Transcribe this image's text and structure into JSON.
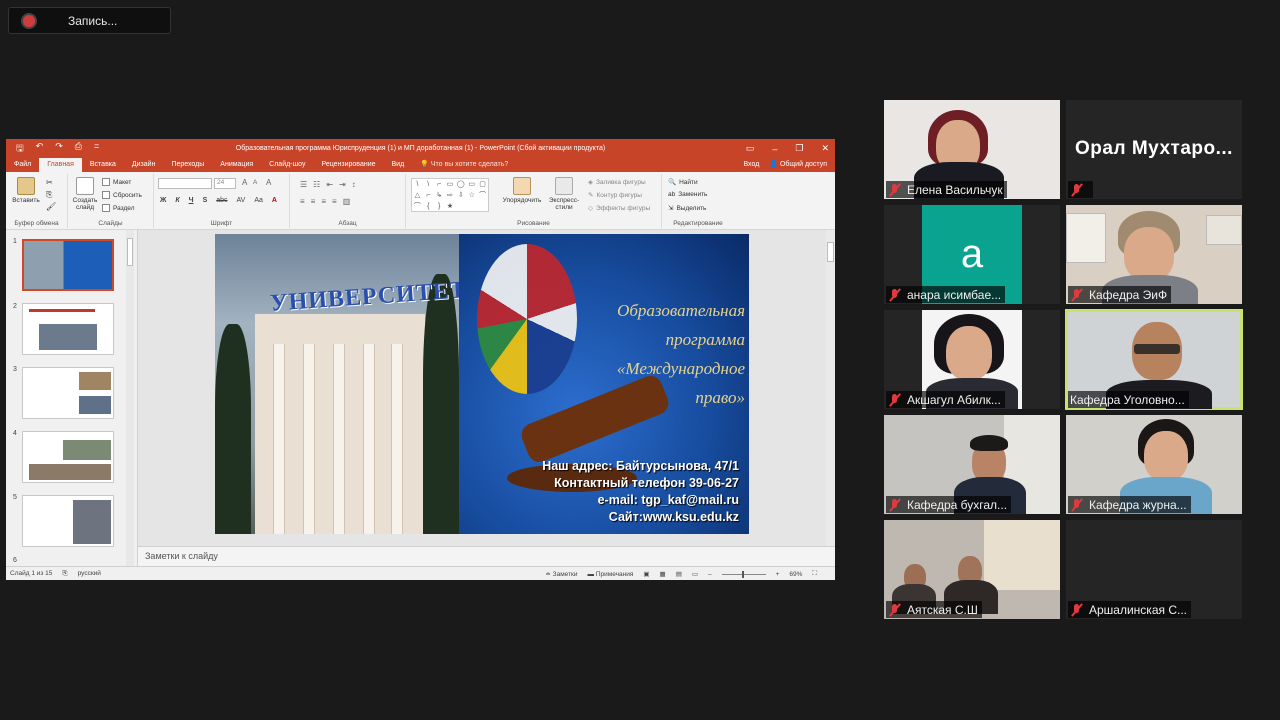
{
  "recording": {
    "label": "Запись..."
  },
  "powerpoint": {
    "qat": [
      "🖫",
      "↶",
      "↷",
      "⎙",
      "="
    ],
    "title": "Образовательная программа Юриспруденция (1) и МП доработанная (1) - PowerPoint (Сбой активации продукта)",
    "window_controls": [
      "▭",
      "–",
      "❐",
      "✕"
    ],
    "tabs": [
      "Файл",
      "Главная",
      "Вставка",
      "Дизайн",
      "Переходы",
      "Анимация",
      "Слайд-шоу",
      "Рецензирование",
      "Вид"
    ],
    "active_tab": "Главная",
    "tell_me": "Что вы хотите сделать?",
    "login": "Вход",
    "share": "Общий доступ",
    "ribbon": {
      "paste": "Вставить",
      "clipboard_group": "Буфер обмена",
      "new_slide": "Создать слайд",
      "layout": "Макет",
      "reset": "Сбросить",
      "section": "Раздел",
      "slides_group": "Слайды",
      "font_size": "24",
      "font_group": "Шрифт",
      "paragraph_group": "Абзац",
      "arrange": "Упорядочить",
      "quick_styles": "Экспресс-стили",
      "shape_fill": "Заливка фигуры",
      "shape_outline": "Контур фигуры",
      "shape_effects": "Эффекты фигуры",
      "drawing_group": "Рисование",
      "find": "Найти",
      "replace": "Заменить",
      "select": "Выделить",
      "editing_group": "Редактирование",
      "format_buttons": [
        "Ж",
        "К",
        "Ч",
        "S",
        "abc",
        "AV",
        "Aa",
        "A"
      ]
    },
    "thumbnails": [
      "1",
      "2",
      "3",
      "4",
      "5",
      "6"
    ],
    "slide": {
      "univ_text": "УНИВЕРСИТЕТ",
      "program_lines": [
        "Образовательная",
        "программа",
        "«Международное право»"
      ],
      "address_lines": [
        "Наш адрес: Байтурсынова, 47/1",
        "Контактный телефон 39-06-27",
        "e-mail: tgp_kaf@mail.ru",
        "Сайт:www.ksu.edu.kz"
      ]
    },
    "notes_placeholder": "Заметки к слайду",
    "status": {
      "slide_info": "Слайд 1 из 15",
      "language": "русский",
      "notes_btn": "Заметки",
      "comments_btn": "Примечания",
      "zoom": "69%"
    }
  },
  "participants": [
    {
      "name": "Елена Васильчук",
      "video": true
    },
    {
      "name": "",
      "display_name": "Орал Мухтаро...",
      "video": false
    },
    {
      "name": "анара исимбае...",
      "avatar_letter": "a",
      "video": false
    },
    {
      "name": "Кафедра ЭиФ",
      "video": true
    },
    {
      "name": "Акшагул Абилк...",
      "video": true
    },
    {
      "name": "Кафедра Уголовно...",
      "video": true,
      "active_speaker": true
    },
    {
      "name": "Кафедра бухгал...",
      "video": true
    },
    {
      "name": "Кафедра журна...",
      "video": true
    },
    {
      "name": "Аятская С.Ш",
      "video": true
    },
    {
      "name": "Аршалинская С...",
      "video": false
    }
  ],
  "colors": {
    "ppt_accent": "#c84428",
    "active_speaker": "#c7e36b",
    "avatar_bg": "#0aa390",
    "mic_muted": "#e0393e"
  }
}
